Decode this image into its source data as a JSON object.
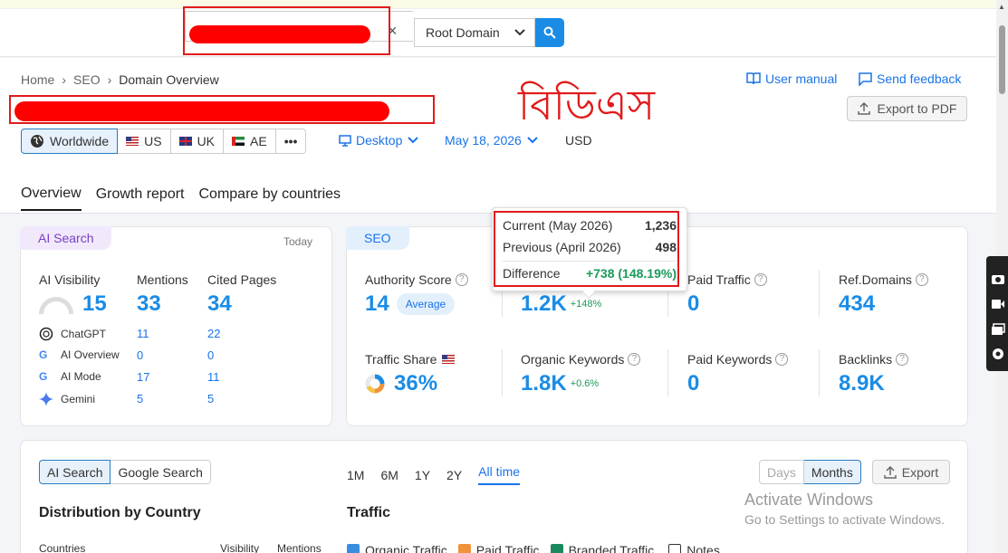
{
  "search": {
    "clear_icon": "×",
    "scope": "Root Domain",
    "button_icon": "search-icon"
  },
  "breadcrumb": [
    "Home",
    "SEO",
    "Domain Overview"
  ],
  "overlay_text": "বিডিএস",
  "header_links": {
    "user_manual": "User manual",
    "send_feedback": "Send feedback",
    "export_pdf": "Export to PDF"
  },
  "regions": [
    "Worldwide",
    "US",
    "UK",
    "AE",
    "•••"
  ],
  "filters": {
    "device": "Desktop",
    "date": "May 18, 2026",
    "currency": "USD"
  },
  "tabs": [
    "Overview",
    "Growth report",
    "Compare by countries"
  ],
  "ai_card": {
    "pill": "AI Search",
    "today": "Today",
    "headers": {
      "visibility": "AI Visibility",
      "mentions": "Mentions",
      "cited": "Cited Pages"
    },
    "visibility": "15",
    "mentions": "33",
    "cited": "34",
    "rows": [
      {
        "name": "ChatGPT",
        "mentions": "11",
        "cited": "22"
      },
      {
        "name": "AI Overview",
        "mentions": "0",
        "cited": "0"
      },
      {
        "name": "AI Mode",
        "mentions": "17",
        "cited": "11"
      },
      {
        "name": "Gemini",
        "mentions": "5",
        "cited": "5"
      }
    ]
  },
  "seo_card": {
    "pill": "SEO",
    "authority_label": "Authority Score",
    "authority_value": "14",
    "authority_badge": "Average",
    "organic_traffic_value": "1.2K",
    "organic_traffic_delta": "+148%",
    "paid_traffic_label": "Paid Traffic",
    "paid_traffic_value": "0",
    "ref_domains_label": "Ref.Domains",
    "ref_domains_value": "434",
    "traffic_share_label": "Traffic Share",
    "traffic_share_value": "36%",
    "organic_keywords_label": "Organic Keywords",
    "organic_keywords_value": "1.8K",
    "organic_keywords_delta": "+0.6%",
    "paid_keywords_label": "Paid Keywords",
    "paid_keywords_value": "0",
    "backlinks_label": "Backlinks",
    "backlinks_value": "8.9K"
  },
  "tooltip": {
    "current_label": "Current (May 2026)",
    "current_value": "1,236",
    "previous_label": "Previous (April 2026)",
    "previous_value": "498",
    "difference_label": "Difference",
    "difference_value": "+738 (148.19%)"
  },
  "lower": {
    "toggle": [
      "AI Search",
      "Google Search"
    ],
    "periods": [
      "1M",
      "6M",
      "1Y",
      "2Y",
      "All time"
    ],
    "granularity": [
      "Days",
      "Months"
    ],
    "export": "Export",
    "distribution_title": "Distribution by Country",
    "traffic_title": "Traffic",
    "columns": [
      "Countries",
      "Visibility",
      "Mentions"
    ],
    "legend": [
      "Organic Traffic",
      "Paid Traffic",
      "Branded Traffic",
      "Notes"
    ],
    "legend_colors": [
      "#3b8de0",
      "#f0923b",
      "#1a8a5e",
      "#ffffff"
    ]
  },
  "watermark": {
    "line1": "Activate Windows",
    "line2": "Go to Settings to activate Windows."
  },
  "colors": {
    "accent": "#1a8ce6",
    "redaction": "#ff0000",
    "positive": "#1a9a5a"
  }
}
